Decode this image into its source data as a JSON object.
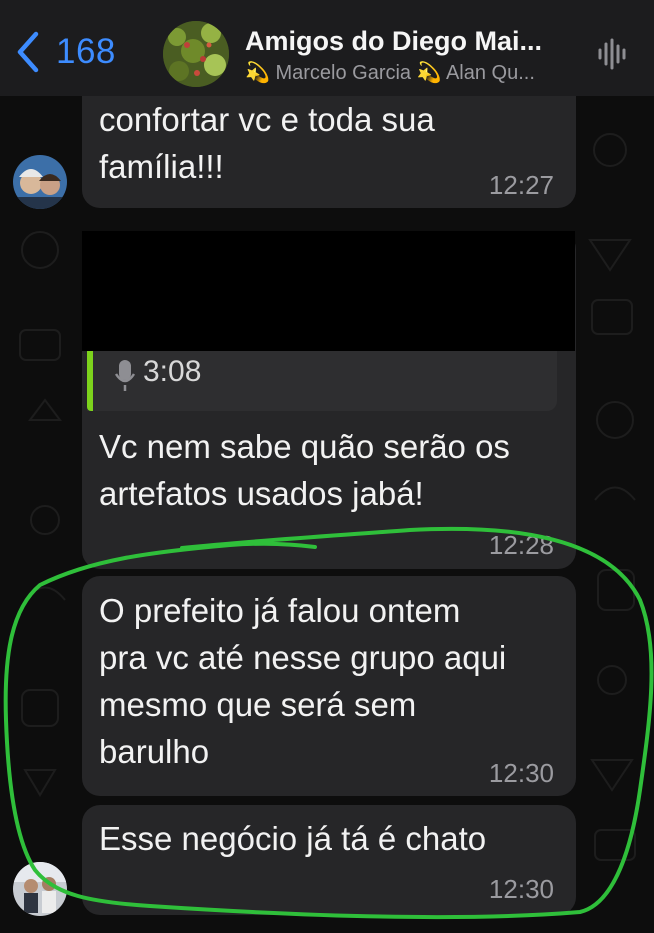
{
  "header": {
    "back_count": "168",
    "title": "Amigos do Diego Mai...",
    "subtitle": "💫 Marcelo Garcia 💫 Alan Qu..."
  },
  "messages": [
    {
      "text_lines": [
        "confortar vc e toda sua",
        "família!!!"
      ],
      "time": "12:27"
    },
    {
      "quote_duration": "3:08",
      "text_lines": [
        "Vc nem sabe quão serão os",
        "artefatos usados jabá!"
      ],
      "time": "12:28"
    },
    {
      "text_lines": [
        "O prefeito já falou ontem",
        "pra vc até nesse grupo aqui",
        "mesmo que será sem",
        "barulho"
      ],
      "time": "12:30"
    },
    {
      "text_lines": [
        "Esse negócio já tá é chato"
      ],
      "time": "12:30"
    }
  ],
  "colors": {
    "accent": "#3d8cff",
    "bubble": "#262628",
    "quote_bar": "#7dd31c",
    "annotation": "#2fbf3a"
  },
  "icons": {
    "back": "chevron-left-icon",
    "header_right": "audio-wave-icon",
    "quote": "microphone-icon"
  }
}
